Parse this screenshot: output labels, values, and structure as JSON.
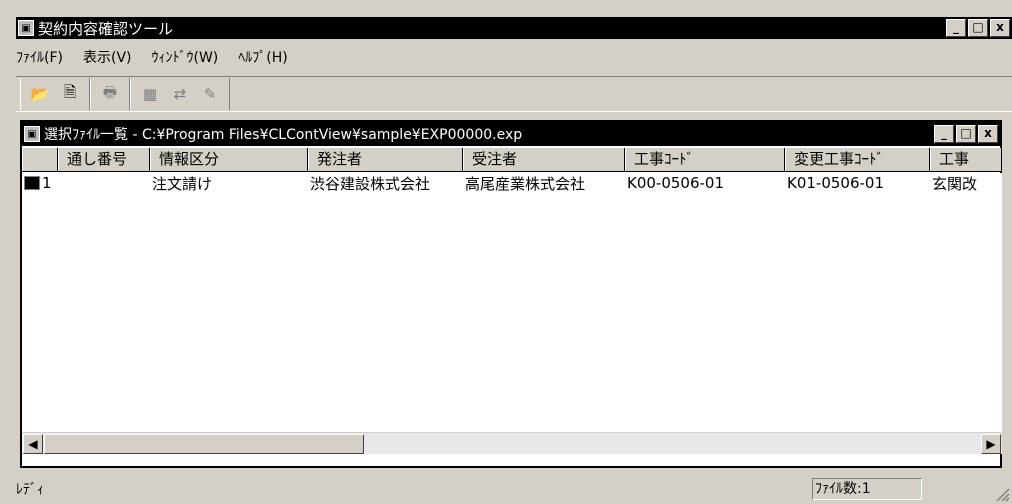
{
  "app": {
    "title": "契約内容確認ツール",
    "window_buttons": [
      "_",
      "□",
      "x"
    ]
  },
  "menu": [
    {
      "label": "ﾌｧｲﾙ(F)"
    },
    {
      "label": "表示(V)"
    },
    {
      "label": "ｳｨﾝﾄﾞｳ(W)"
    },
    {
      "label": "ﾍﾙﾌﾟ(H)"
    }
  ],
  "toolbar": {
    "groups": [
      [
        {
          "name": "open-folder-icon",
          "glyph": "📂",
          "disabled": false
        },
        {
          "name": "document-icon",
          "glyph": "🗎",
          "disabled": false
        }
      ],
      [
        {
          "name": "print-icon",
          "glyph": "🖶",
          "disabled": true
        }
      ],
      [
        {
          "name": "properties-icon",
          "glyph": "▦",
          "disabled": true
        },
        {
          "name": "export-icon",
          "glyph": "⇄",
          "disabled": true
        },
        {
          "name": "edit-icon",
          "glyph": "✎",
          "disabled": true
        }
      ]
    ]
  },
  "child": {
    "title": "選択ﾌｧｲﾙ一覧 - C:¥Program Files¥CLContView¥sample¥EXP00000.exp",
    "columns": [
      "",
      "通し番号",
      "情報区分",
      "発注者",
      "受注者",
      "工事ｺｰﾄﾞ",
      "変更工事ｺｰﾄﾞ",
      "工事"
    ],
    "rows": [
      [
        "1",
        "注文請け",
        "渋谷建設株式会社",
        "高尾産業株式会社",
        "K00-0506-01",
        "K01-0506-01",
        "玄関改"
      ]
    ]
  },
  "status": {
    "left": "ﾚﾃﾞｨ",
    "file_count": "ﾌｧｲﾙ数:1"
  }
}
